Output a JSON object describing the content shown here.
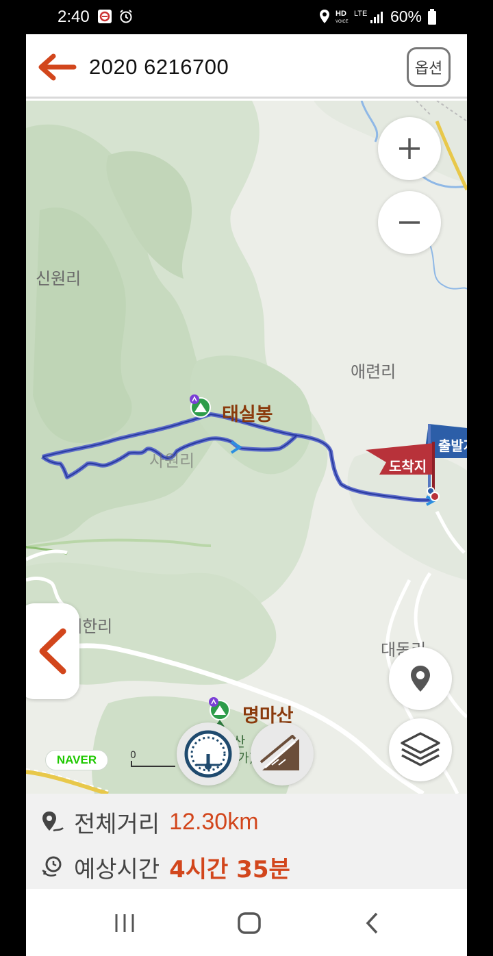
{
  "status_bar": {
    "time": "2:40",
    "hd_label": "HD",
    "voice_label": "VOICE",
    "lte_label": "LTE",
    "battery": "60%"
  },
  "header": {
    "title": "2020 6216700",
    "options_label": "옵션"
  },
  "map": {
    "labels": {
      "sinwon": "신원리",
      "aeryeon": "애련리",
      "haehan": "해한리",
      "daedong": "대동리",
      "village_mid": "사원리",
      "fragment_a": "산",
      "fragment_b": "(가)"
    },
    "peaks": {
      "taesil": "태실봉",
      "myeongma": "명마산"
    },
    "flags": {
      "arrival": "도착지",
      "departure": "출발지"
    },
    "naver": "NAVER",
    "scale_zero": "0"
  },
  "route": {
    "color": "#3a48b8"
  },
  "info": {
    "distance_label": "전체거리",
    "distance_value": "12.30km",
    "time_label": "예상시간",
    "time_value": "4시간 35분"
  },
  "colors": {
    "accent": "#d2461c",
    "route": "#3a48b8",
    "arrival_flag": "#b8323a",
    "departure_flag": "#2c5ea8"
  }
}
